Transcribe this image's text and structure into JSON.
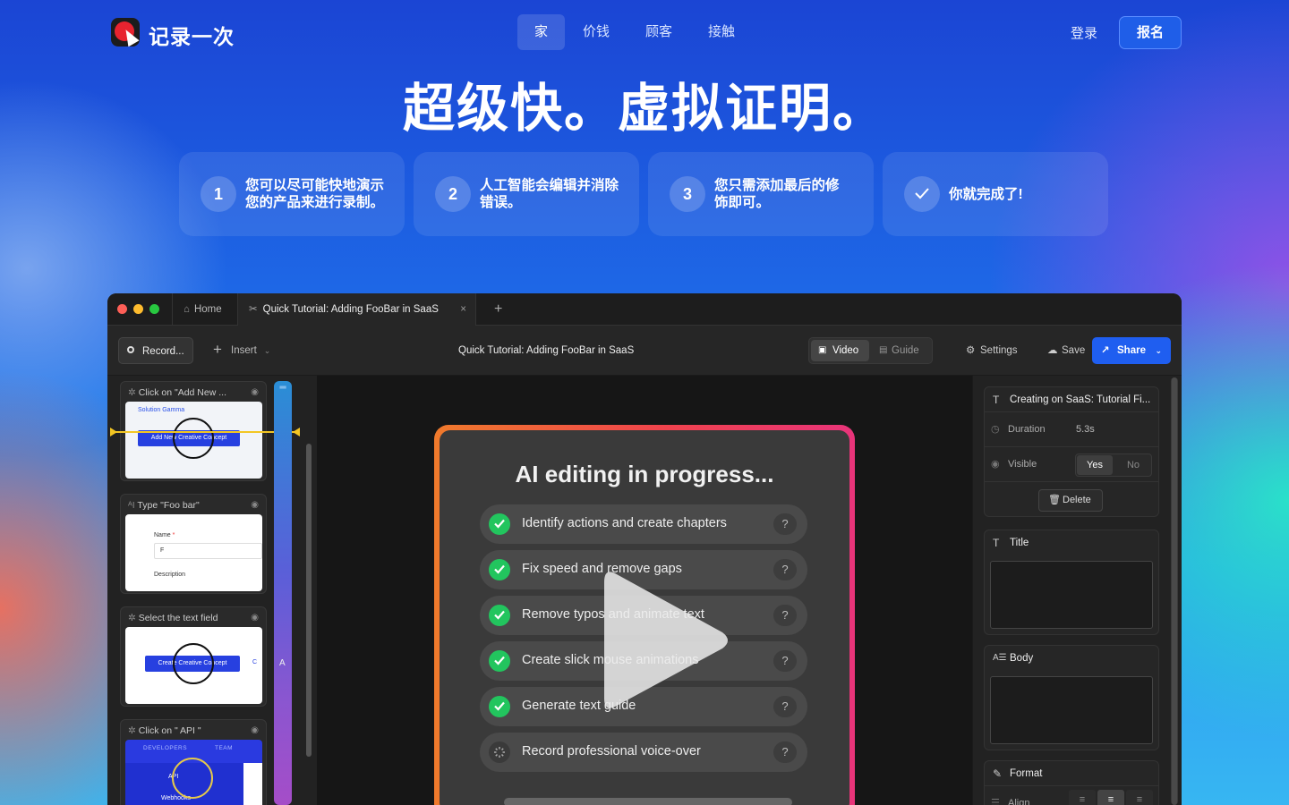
{
  "brand": "记录一次",
  "nav": {
    "items": [
      "家",
      "价钱",
      "顾客",
      "接触"
    ],
    "login": "登录",
    "signup": "报名"
  },
  "headline": "超级快。虚拟证明。",
  "steps": [
    {
      "num": "1",
      "text": "您可以尽可能快地演示您的产品来进行录制。"
    },
    {
      "num": "2",
      "text": "人工智能会编辑并消除错误。"
    },
    {
      "num": "3",
      "text": "您只需添加最后的修饰即可。"
    },
    {
      "num": "",
      "text": "你就完成了!"
    }
  ],
  "app": {
    "tabs": {
      "home": "Home",
      "current": "Quick Tutorial: Adding FooBar in SaaS",
      "close": "×",
      "new": "+"
    },
    "toolbar": {
      "record": "Record...",
      "insert": "Insert",
      "title": "Quick Tutorial: Adding FooBar in SaaS",
      "video": "Video",
      "guide": "Guide",
      "settings": "Settings",
      "save": "Save",
      "share": "Share"
    },
    "clips": [
      {
        "label": "Click on \"Add New ...",
        "shot_title": "Solution Gamma",
        "shot_button": "Add New Creative Concept"
      },
      {
        "label": "Type \"Foo bar\"",
        "shot_name": "Name",
        "shot_star": "*",
        "shot_value": "F",
        "shot_desc": "Description"
      },
      {
        "label": "Select the text field",
        "shot_button": "Create Creative Concept",
        "shot_side": "C"
      },
      {
        "label": "Click on \" API \"",
        "shot_menu1": "DEVELOPERS",
        "shot_menu2": "TEAM",
        "shot_item1": "API",
        "shot_item2": "Webhooks"
      }
    ],
    "timeline_marker": "A",
    "card": {
      "title": "AI editing in progress...",
      "items": [
        {
          "text": "Identify actions and create chapters",
          "done": true
        },
        {
          "text": "Fix speed and remove gaps",
          "done": true
        },
        {
          "text": "Remove typos and animate text",
          "done": true
        },
        {
          "text": "Create slick mouse animations",
          "done": true
        },
        {
          "text": "Generate text guide",
          "done": true
        },
        {
          "text": "Record professional voice-over",
          "done": false
        }
      ],
      "help": "?"
    },
    "panel": {
      "header": "Creating on SaaS: Tutorial Fi...",
      "duration_label": "Duration",
      "duration_value": "5.3s",
      "visible_label": "Visible",
      "yes": "Yes",
      "no": "No",
      "delete": "Delete",
      "title_label": "Title",
      "body_label": "Body",
      "format_label": "Format",
      "align_label": "Align"
    }
  },
  "colors": {
    "accent": "#1f5ef0",
    "check": "#22c55e",
    "record_red": "#e8232f"
  }
}
